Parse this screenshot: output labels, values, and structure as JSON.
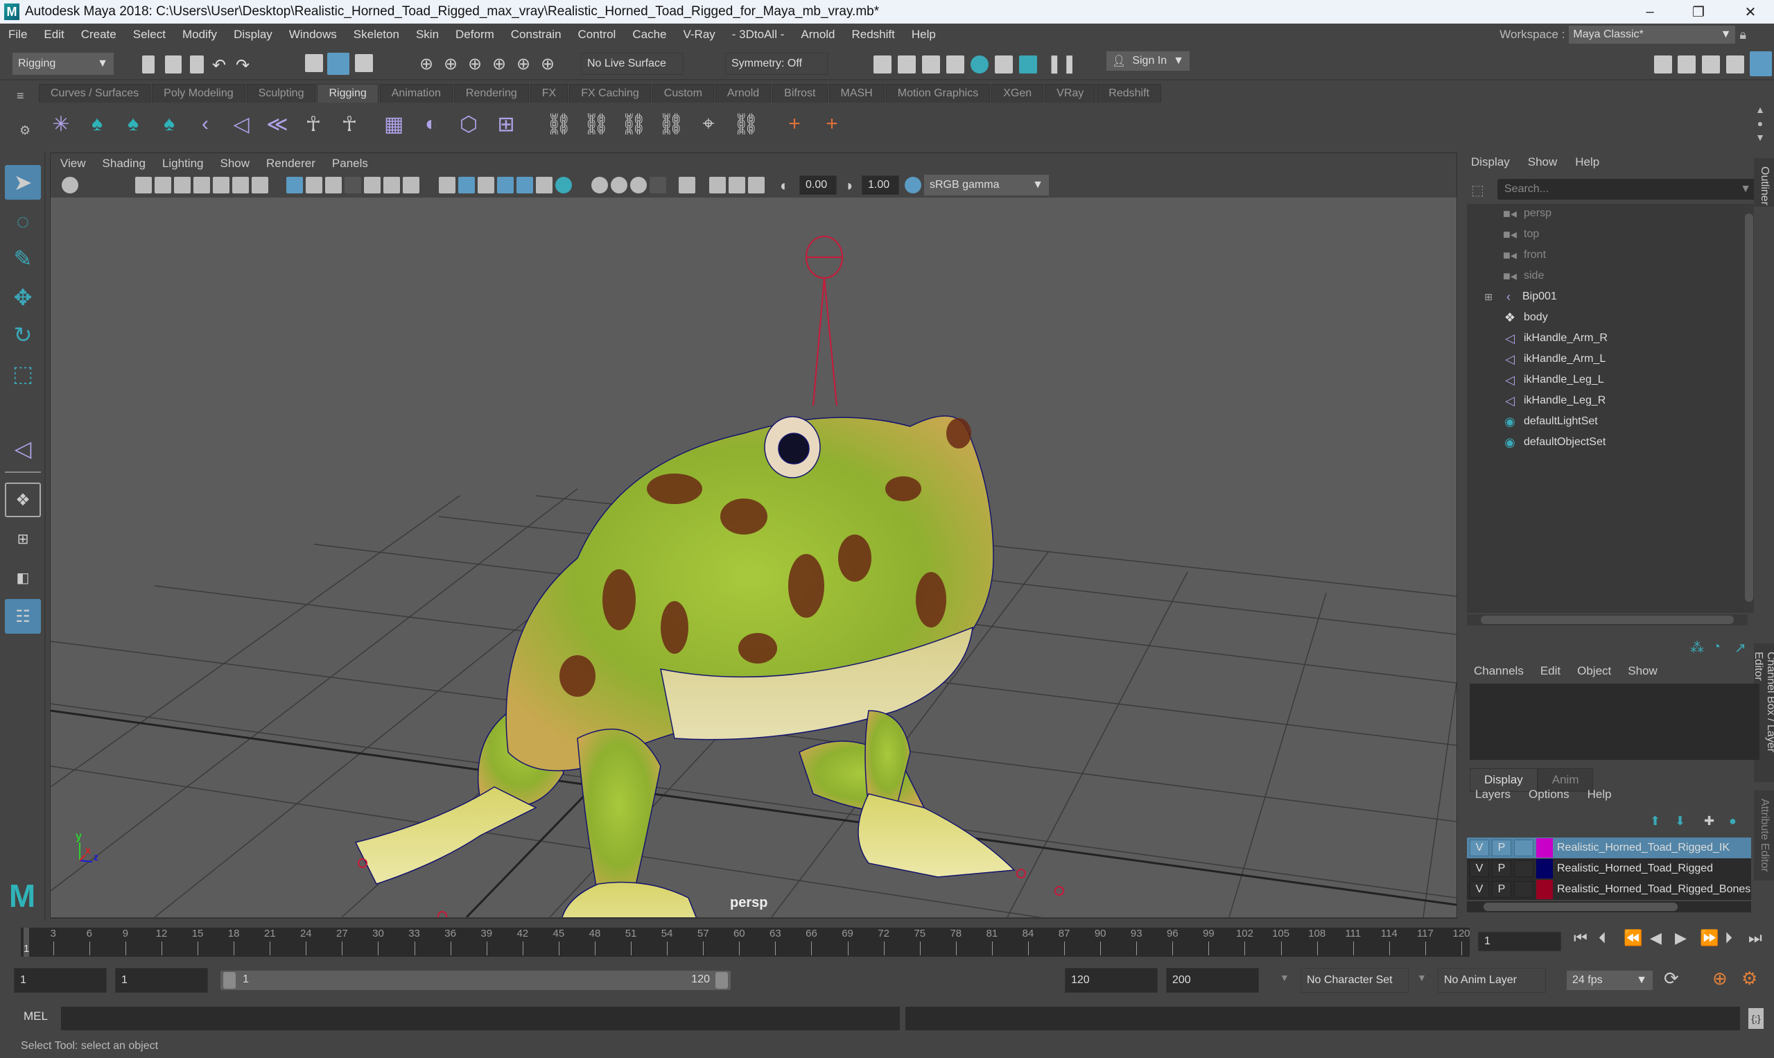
{
  "window": {
    "title": "Autodesk Maya 2018: C:\\Users\\User\\Desktop\\Realistic_Horned_Toad_Rigged_max_vray\\Realistic_Horned_Toad_Rigged_for_Maya_mb_vray.mb*",
    "logo_letter": "M",
    "minimize": "–",
    "restore": "❐",
    "close": "✕"
  },
  "menubar": {
    "items": [
      "File",
      "Edit",
      "Create",
      "Select",
      "Modify",
      "Display",
      "Windows",
      "Skeleton",
      "Skin",
      "Deform",
      "Constrain",
      "Control",
      "Cache",
      "V-Ray",
      "- 3DtoAll -",
      "Arnold",
      "Redshift",
      "Help"
    ],
    "workspace_label": "Workspace :",
    "workspace_value": "Maya Classic*"
  },
  "statusline": {
    "menuset": "Rigging",
    "live_surface": "No Live Surface",
    "symmetry": "Symmetry: Off",
    "sign_in": "Sign In"
  },
  "shelf": {
    "tabs": [
      "Curves / Surfaces",
      "Poly Modeling",
      "Sculpting",
      "Rigging",
      "Animation",
      "Rendering",
      "FX",
      "FX Caching",
      "Custom",
      "Arnold",
      "Bifrost",
      "MASH",
      "Motion Graphics",
      "XGen",
      "VRay",
      "Redshift"
    ],
    "active_tab": "Rigging"
  },
  "viewport": {
    "menu": [
      "View",
      "Shading",
      "Lighting",
      "Show",
      "Renderer",
      "Panels"
    ],
    "exposure": "0.00",
    "gamma": "1.00",
    "color_space": "sRGB gamma",
    "camera_label": "persp",
    "axis": {
      "x": "x",
      "y": "y",
      "z": "z"
    }
  },
  "outliner": {
    "menu": [
      "Display",
      "Show",
      "Help"
    ],
    "search_placeholder": "Search...",
    "side_tab": "Outliner",
    "items": [
      {
        "label": "persp",
        "icon": "camera-icon",
        "dim": true
      },
      {
        "label": "top",
        "icon": "camera-icon",
        "dim": true
      },
      {
        "label": "front",
        "icon": "camera-icon",
        "dim": true
      },
      {
        "label": "side",
        "icon": "camera-icon",
        "dim": true
      },
      {
        "label": "Bip001",
        "icon": "joint-icon",
        "expandable": true
      },
      {
        "label": "body",
        "icon": "mesh-icon"
      },
      {
        "label": "ikHandle_Arm_R",
        "icon": "ik-handle-icon"
      },
      {
        "label": "ikHandle_Arm_L",
        "icon": "ik-handle-icon"
      },
      {
        "label": "ikHandle_Leg_L",
        "icon": "ik-handle-icon"
      },
      {
        "label": "ikHandle_Leg_R",
        "icon": "ik-handle-icon"
      },
      {
        "label": "defaultLightSet",
        "icon": "set-icon"
      },
      {
        "label": "defaultObjectSet",
        "icon": "set-icon"
      }
    ]
  },
  "channelbox": {
    "menu": [
      "Channels",
      "Edit",
      "Object",
      "Show"
    ],
    "side_tab": "Channel Box / Layer Editor",
    "side_tab2": "Attribute Editor",
    "layer_tabs": [
      "Display",
      "Anim"
    ],
    "layer_menu": [
      "Layers",
      "Options",
      "Help"
    ],
    "layers": [
      {
        "v": "V",
        "p": "P",
        "name": "Realistic_Horned_Toad_Rigged_IK",
        "color": "#c800c8",
        "selected": true
      },
      {
        "v": "V",
        "p": "P",
        "name": "Realistic_Horned_Toad_Rigged",
        "color": "#000066",
        "selected": false
      },
      {
        "v": "V",
        "p": "P",
        "name": "Realistic_Horned_Toad_Rigged_Bones",
        "color": "#990022",
        "selected": false
      }
    ]
  },
  "timeline": {
    "ticks": [
      3,
      6,
      9,
      12,
      15,
      18,
      21,
      24,
      27,
      30,
      33,
      36,
      39,
      42,
      45,
      48,
      51,
      54,
      57,
      60,
      63,
      66,
      69,
      72,
      75,
      78,
      81,
      84,
      87,
      90,
      93,
      96,
      99,
      102,
      105,
      108,
      111,
      114,
      117,
      120
    ],
    "current_frame": "1",
    "current_frame_field": "1",
    "range_start": "1",
    "playback_start": "1",
    "slider_start": "1",
    "slider_end": "120",
    "playback_end": "120",
    "range_end": "200",
    "character_set": "No Character Set",
    "anim_layer": "No Anim Layer",
    "fps": "24 fps"
  },
  "command": {
    "label": "MEL",
    "help_text": "Select Tool: select an object"
  }
}
